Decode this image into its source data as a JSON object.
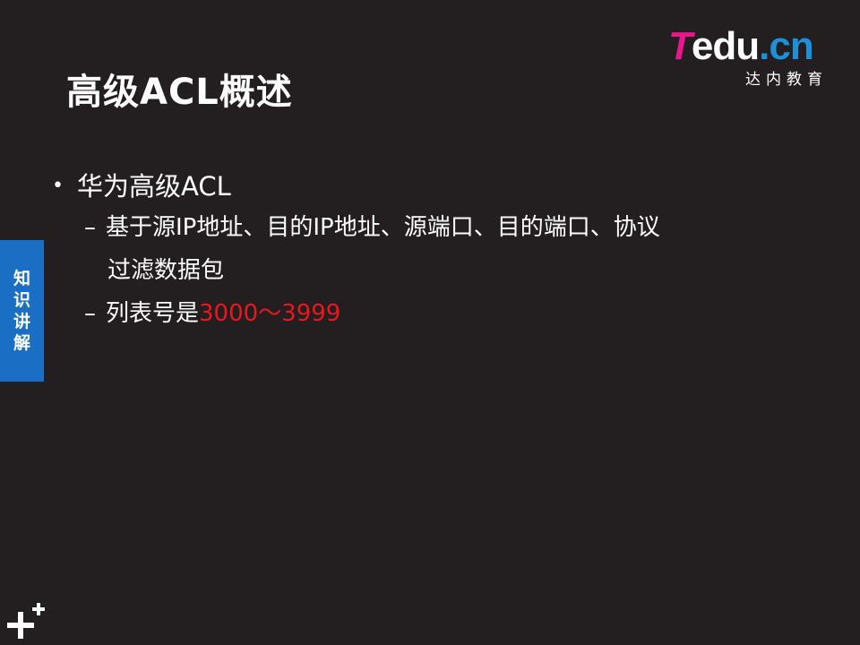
{
  "slide": {
    "title": "高级ACL概述",
    "logo": {
      "brand_t": "T",
      "brand_mid": "edu",
      "brand_cn": ".cn",
      "subtitle": "达内教育",
      "accent_color": "#e8178a",
      "cn_color": "#1e90d8"
    },
    "side_tab": {
      "label": "知识讲解",
      "color": "#1a6fc4"
    },
    "content": {
      "bullet_1": "华为高级ACL",
      "sub_1_line1": "基于源IP地址、目的IP地址、源端口、目的端口、协议",
      "sub_1_line2": "过滤数据包",
      "sub_2_prefix": "列表号是",
      "sub_2_value": "3000～3999",
      "bullet_symbol": "•",
      "dash_symbol": "–"
    },
    "bottom_icon": "plus-plus-icon",
    "highlight_color": "#e8181e",
    "background_color": "#231f20"
  }
}
